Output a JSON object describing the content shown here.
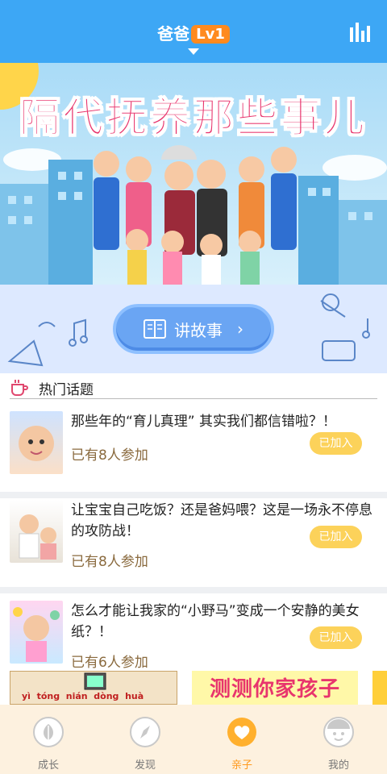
{
  "header": {
    "user_role": "爸爸",
    "level_badge": "Lv1"
  },
  "banner": {
    "title": "隔代抚养那些事儿"
  },
  "story_button": {
    "label": "讲故事"
  },
  "hot_topics": {
    "heading": "热门话题",
    "items": [
      {
        "title": "那些年的“育儿真理” 其实我们都信错啦？！",
        "participants": "已有8人参加",
        "status": "已加入"
      },
      {
        "title": "让宝宝自己吃饭？还是爸妈喂？这是一场永不停息的攻防战！",
        "participants": "已有8人参加",
        "status": "已加入"
      },
      {
        "title": "怎么才能让我家的“小野马”变成一个安静的美女纸？！",
        "participants": "已有6人参加",
        "status": "已加入"
      }
    ]
  },
  "promos": [
    {
      "pinyin": "yì  tóng  nián  dòng  huà"
    },
    {
      "title": "测测你家孩子"
    }
  ],
  "tabbar": {
    "tabs": [
      {
        "label": "成长",
        "icon": "leaf-icon"
      },
      {
        "label": "发现",
        "icon": "compass-icon"
      },
      {
        "label": "亲子",
        "icon": "heart-icon",
        "active": true
      },
      {
        "label": "我的",
        "icon": "face-icon"
      }
    ]
  },
  "colors": {
    "header_bg": "#3da7f5",
    "accent": "#ff9a1e",
    "badge": "#ff8a1e",
    "joined": "#fcd25a",
    "tabbar_bg": "#fdf1df"
  }
}
